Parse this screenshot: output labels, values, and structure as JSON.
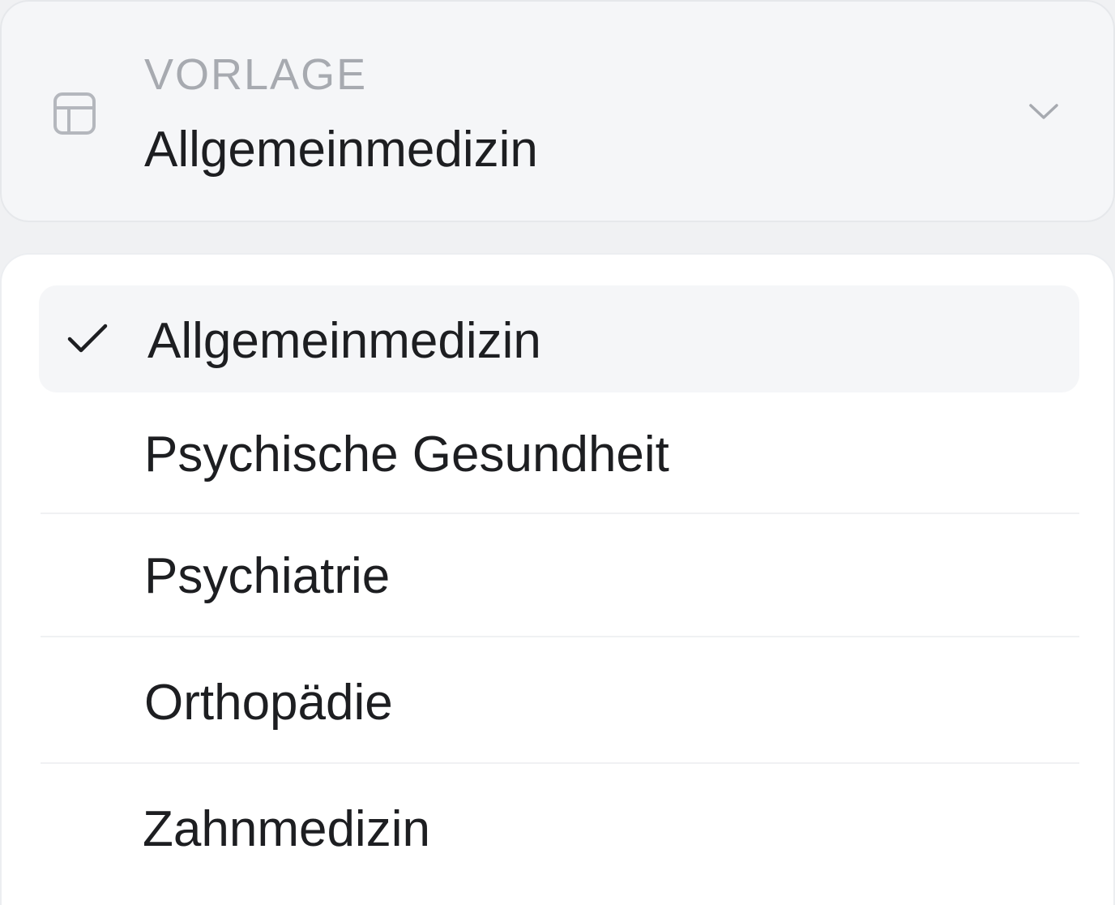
{
  "select": {
    "label": "VORLAGE",
    "value": "Allgemeinmedizin",
    "icon": "template-layout-icon",
    "chevron_icon": "chevron-down-icon"
  },
  "menu": {
    "check_icon": "check-icon",
    "selected_index": 0,
    "options": [
      {
        "label": "Allgemeinmedizin"
      },
      {
        "label": "Psychische Gesundheit"
      },
      {
        "label": "Psychiatrie"
      },
      {
        "label": "Orthopädie"
      },
      {
        "label": "Zahnmedizin"
      }
    ]
  },
  "colors": {
    "trigger_bg": "#f5f6f8",
    "menu_bg": "#ffffff",
    "text_primary": "#1d1e21",
    "text_muted": "#a7aab0",
    "selected_bg": "#f5f6f8"
  }
}
